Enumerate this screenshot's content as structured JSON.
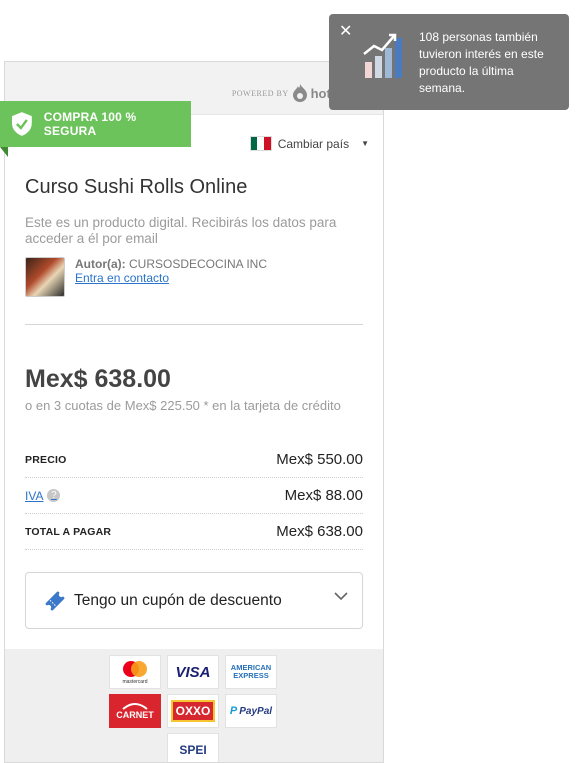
{
  "header": {
    "powered_by": "POWERED BY",
    "brand": "hotmart"
  },
  "secure_badge": {
    "label": "COMPRA 100 % SEGURA"
  },
  "country": {
    "label": "Cambiar país"
  },
  "product": {
    "title": "Curso Sushi Rolls Online",
    "description": "Este es un producto digital. Recibirás los datos para acceder a él por email",
    "author_label": "Autor(a):",
    "author_name": "CURSOSDECOCINA INC",
    "contact_link": "Entra en contacto"
  },
  "pricing": {
    "total_display": "Mex$ 638.00",
    "installments": "o en 3 cuotas de Mex$ 225.50 * en la tarjeta de crédito",
    "rows": [
      {
        "label": "PRECIO",
        "value": "Mex$ 550.00"
      },
      {
        "label": "IVA",
        "value": "Mex$ 88.00"
      },
      {
        "label": "TOTAL A PAGAR",
        "value": "Mex$ 638.00"
      }
    ]
  },
  "coupon": {
    "label": "Tengo un cupón de descuento"
  },
  "payment_methods": {
    "mastercard": "mastercard",
    "visa": "VISA",
    "amex_line1": "AMERICAN",
    "amex_line2": "EXPRESS",
    "carnet": "CARNET",
    "oxxo": "OXXO",
    "paypal": "PayPal",
    "spei": "SPEI"
  },
  "toast": {
    "message": "108 personas también tuvieron interés en este producto la última semana."
  },
  "colors": {
    "secure_green": "#6cc35b",
    "link_blue": "#2a74c9",
    "toast_bg": "#757575"
  }
}
